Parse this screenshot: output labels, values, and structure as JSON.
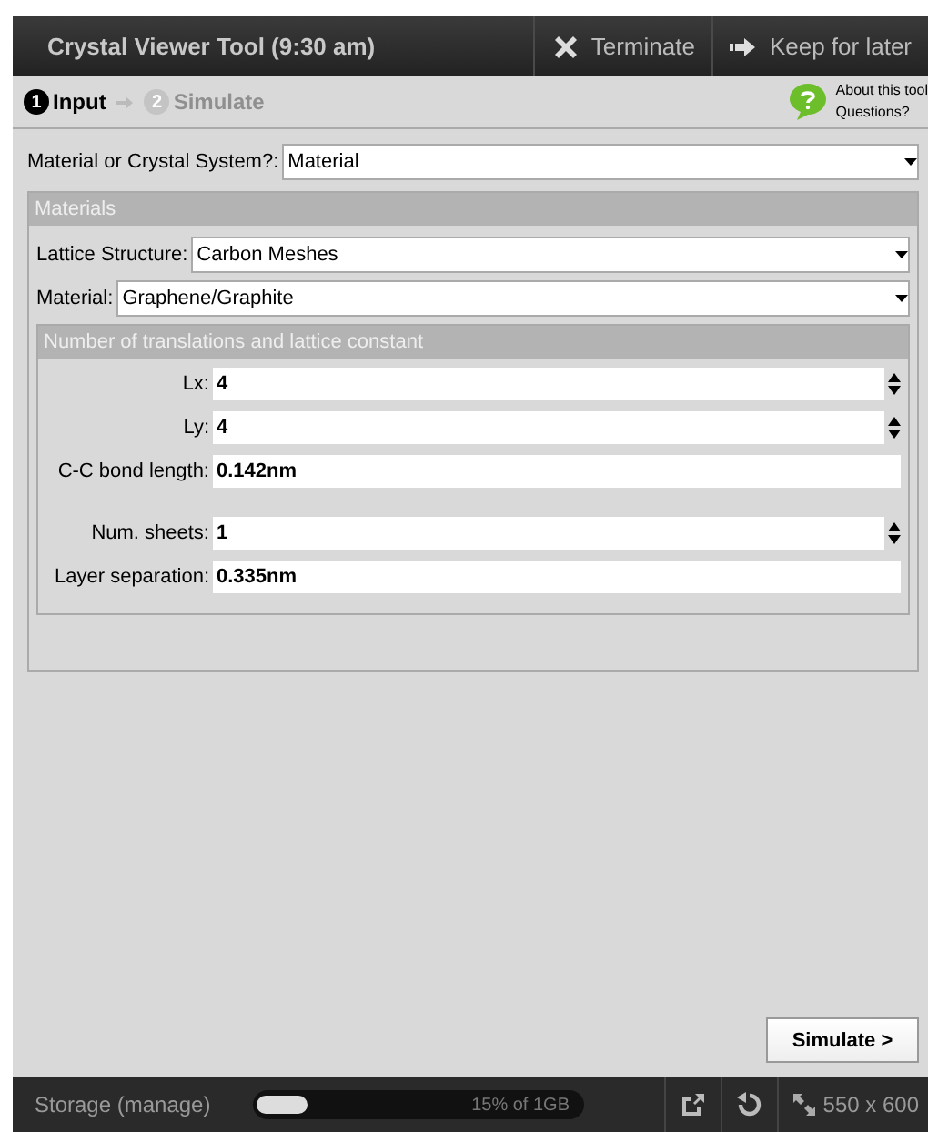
{
  "window": {
    "title": "Crystal Viewer Tool (9:30 am)",
    "actions": [
      {
        "kind": "terminate",
        "label": "Terminate"
      },
      {
        "kind": "keep",
        "label": "Keep for later"
      }
    ]
  },
  "steps": [
    {
      "number": "1",
      "label": "Input",
      "selected": true
    },
    {
      "number": "2",
      "label": "Simulate",
      "selected": false
    }
  ],
  "help": {
    "lines": [
      "About this tool",
      "Questions?"
    ]
  },
  "system_select": {
    "label": "Material or Crystal System?:",
    "value": "Material"
  },
  "materials": {
    "title": "Materials",
    "selects": [
      {
        "label": "Lattice Structure:",
        "value": "Carbon Meshes"
      },
      {
        "label": "Material:",
        "value": "Graphene/Graphite"
      }
    ],
    "translations": {
      "title": "Number of translations and lattice constant",
      "groups": [
        [
          {
            "kind": "spinner",
            "label": "Lx:",
            "value": "4"
          },
          {
            "kind": "spinner",
            "label": "Ly:",
            "value": "4"
          },
          {
            "kind": "text",
            "label": "C-C bond length:",
            "value": "0.142nm"
          }
        ],
        [
          {
            "kind": "spinner",
            "label": "Num. sheets:",
            "value": "1"
          },
          {
            "kind": "text",
            "label": "Layer separation:",
            "value": "0.335nm"
          }
        ]
      ]
    }
  },
  "simulate_button": "Simulate >",
  "status_bar": {
    "storage_label": "Storage (manage)",
    "storage": {
      "level": 0.15,
      "reading": "15% of 1GB"
    },
    "size": "550 x 600"
  }
}
